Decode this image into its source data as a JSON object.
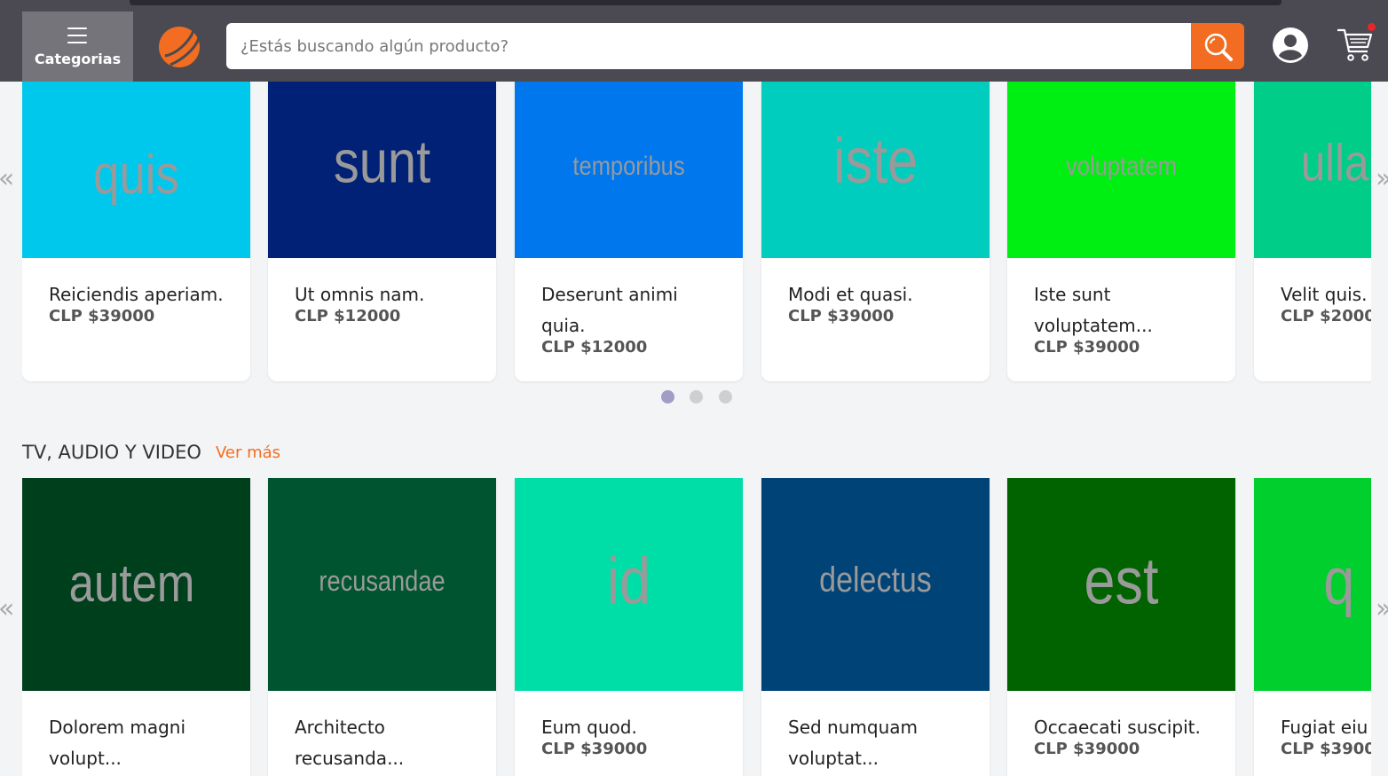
{
  "header": {
    "categories_label": "Categorias",
    "search_placeholder": "¿Estás buscando algún producto?"
  },
  "colors": {
    "header_bg": "#4b4a52",
    "accent": "#f26d21",
    "cart_badge": "#e8262a"
  },
  "carousel_top": {
    "products": [
      {
        "image_text": "quis",
        "image_bg": "#00c8ec",
        "name": "Reiciendis aperiam.",
        "price": "CLP $39000"
      },
      {
        "image_text": "sunt",
        "image_bg": "#002175",
        "name": "Ut omnis nam.",
        "price": "CLP $12000"
      },
      {
        "image_text": "temporibus",
        "image_bg": "#0077ec",
        "name": "Deserunt animi quia.",
        "price": "CLP $12000"
      },
      {
        "image_text": "iste",
        "image_bg": "#00cdbd",
        "name": "Modi et quasi.",
        "price": "CLP $39000"
      },
      {
        "image_text": "voluptatem",
        "image_bg": "#00ef12",
        "name": "Iste sunt voluptatem...",
        "price": "CLP $39000"
      },
      {
        "image_text": "ulla",
        "image_bg": "#00cd87",
        "name": "Velit quis.",
        "price": "CLP $2000"
      }
    ],
    "pagination": {
      "pages": 3,
      "current": 1
    }
  },
  "section_tv": {
    "title": "TV, AUDIO Y VIDEO",
    "see_more": "Ver más",
    "products": [
      {
        "image_text": "autem",
        "image_bg": "#003f1c",
        "name": "Dolorem magni volupt...",
        "price": ""
      },
      {
        "image_text": "recusandae",
        "image_bg": "#005530",
        "name": "Architecto recusanda...",
        "price": ""
      },
      {
        "image_text": "id",
        "image_bg": "#00dea8",
        "name": "Eum quod.",
        "price": "CLP $39000"
      },
      {
        "image_text": "delectus",
        "image_bg": "#004377",
        "name": "Sed numquam voluptat...",
        "price": ""
      },
      {
        "image_text": "est",
        "image_bg": "#006300",
        "name": "Occaecati suscipit.",
        "price": "CLP $39000"
      },
      {
        "image_text": "q",
        "image_bg": "#00cf2d",
        "name": "Fugiat eiu",
        "price": "CLP $3900"
      }
    ]
  },
  "arrows": {
    "prev": "«",
    "next": "»"
  }
}
